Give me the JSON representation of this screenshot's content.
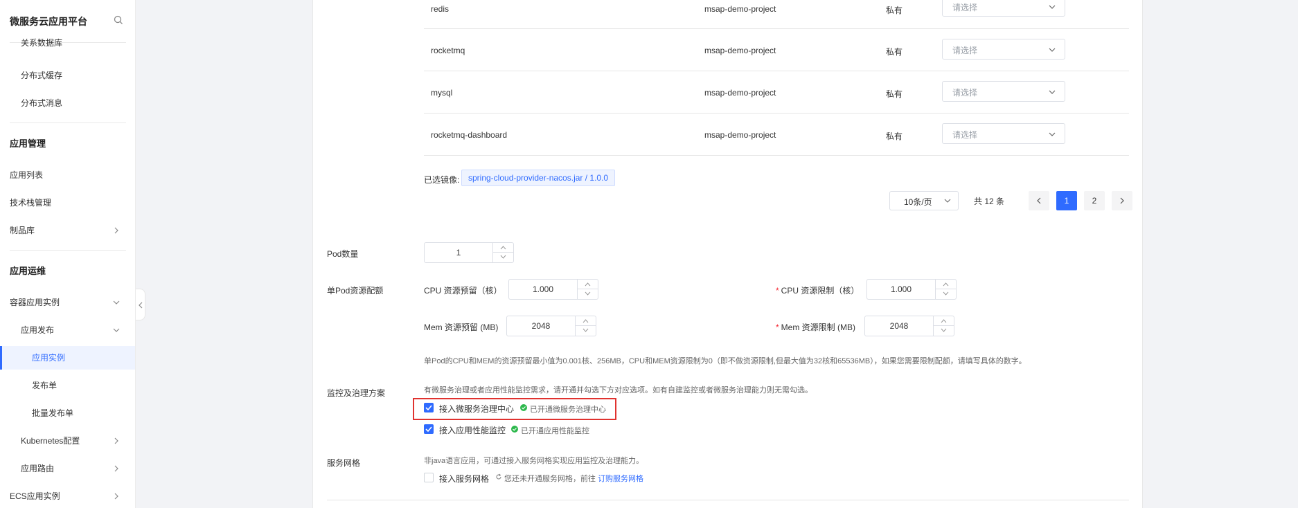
{
  "sidebar": {
    "title": "微服务云应用平台",
    "items_top": [
      "关系数据库",
      "分布式缓存",
      "分布式消息"
    ],
    "group_app_mgmt": "应用管理",
    "app_mgmt_items": [
      "应用列表",
      "技术栈管理",
      "制品库"
    ],
    "group_app_ops": "应用运维",
    "ops_items": {
      "container": "容器应用实例",
      "publish": "应用发布",
      "instance": "应用实例",
      "release_order": "发布单",
      "batch_release": "批量发布单",
      "k8s": "Kubernetes配置",
      "route": "应用路由",
      "ecs": "ECS应用实例"
    }
  },
  "table": {
    "rows": [
      {
        "name": "redis",
        "project": "msap-demo-project",
        "type": "私有",
        "select": "请选择"
      },
      {
        "name": "rocketmq",
        "project": "msap-demo-project",
        "type": "私有",
        "select": "请选择"
      },
      {
        "name": "mysql",
        "project": "msap-demo-project",
        "type": "私有",
        "select": "请选择"
      },
      {
        "name": "rocketmq-dashboard",
        "project": "msap-demo-project",
        "type": "私有",
        "select": "请选择"
      }
    ]
  },
  "selected_image": {
    "label": "已选镜像:",
    "value": "spring-cloud-provider-nacos.jar / 1.0.0"
  },
  "pagination": {
    "page_size": "10条/页",
    "total": "共 12 条",
    "pages": [
      "1",
      "2"
    ],
    "current": "1"
  },
  "form": {
    "pod_count_label": "Pod数量",
    "pod_count": "1",
    "resource_label": "单Pod资源配额",
    "cpu_reserve_label": "CPU 资源预留（核）",
    "cpu_reserve": "1.000",
    "cpu_limit_label": "CPU 资源限制（核）",
    "cpu_limit": "1.000",
    "mem_reserve_label": "Mem 资源预留 (MB)",
    "mem_reserve": "2048",
    "mem_limit_label": "Mem 资源限制 (MB)",
    "mem_limit": "2048",
    "resource_hint": "单Pod的CPU和MEM的资源预留最小值为0.001核、256MB，CPU和MEM资源限制为0（即不做资源限制,但最大值为32核和65536MB），如果您需要限制配额，请填写具体的数字。",
    "monitor_label": "监控及治理方案",
    "monitor_hint": "有微服务治理或者应用性能监控需求，请开通并勾选下方对应选项。如有自建监控或者微服务治理能力则无需勾选。",
    "monitor_opt1": "接入微服务治理中心",
    "monitor_opt1_status": "已开通微服务治理中心",
    "monitor_opt1_checked": true,
    "monitor_opt2": "接入应用性能监控",
    "monitor_opt2_status": "已开通应用性能监控",
    "monitor_opt2_checked": true,
    "mesh_label": "服务网格",
    "mesh_hint": "非java语言应用，可通过接入服务网格实现应用监控及治理能力。",
    "mesh_opt": "接入服务网格",
    "mesh_opt_checked": false,
    "mesh_status": "您还未开通服务网格，前往",
    "mesh_link": "订购服务网格"
  },
  "colors": {
    "accent": "#2f6bff",
    "success": "#2db84d",
    "highlight_box": "#e0322f"
  }
}
